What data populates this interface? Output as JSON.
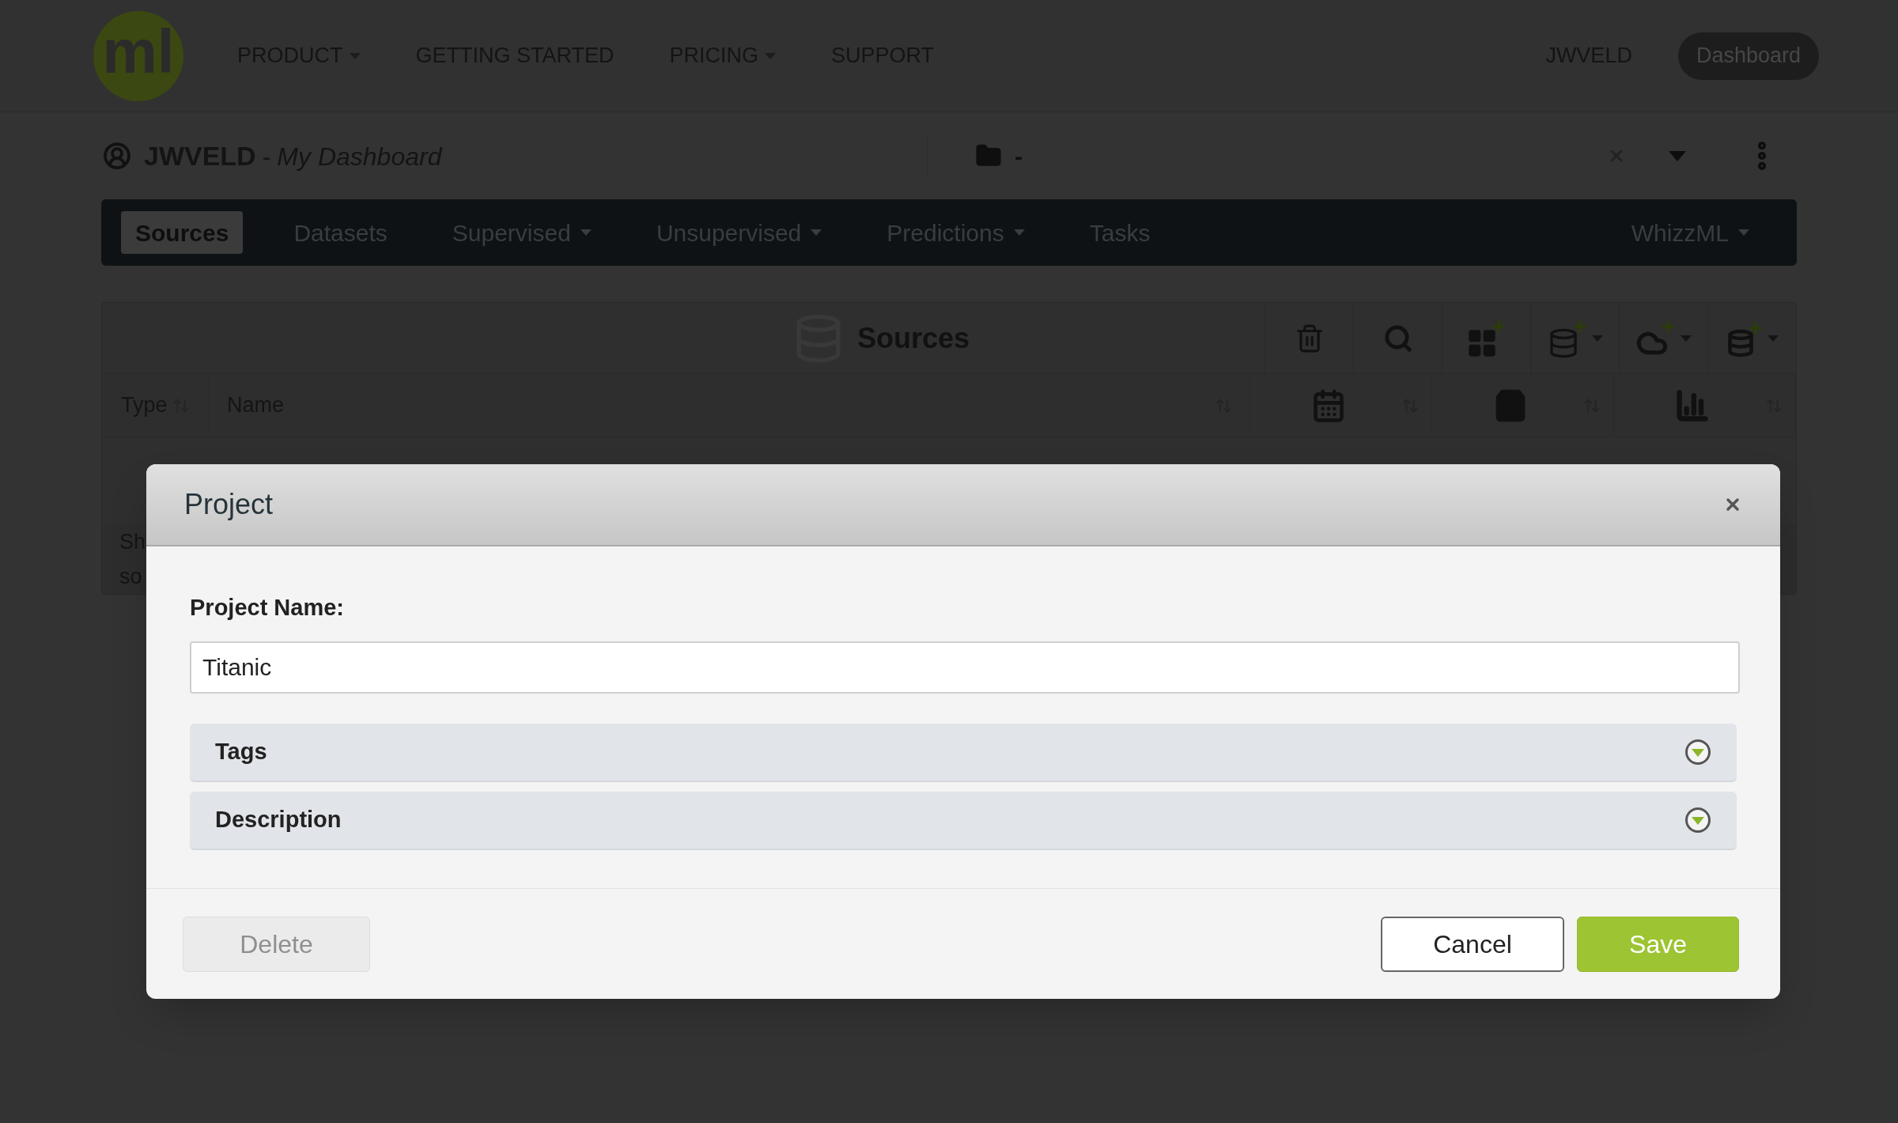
{
  "top_nav": {
    "logo": "ml",
    "items": [
      {
        "label": "PRODUCT",
        "dropdown": true
      },
      {
        "label": "GETTING STARTED",
        "dropdown": false
      },
      {
        "label": "PRICING",
        "dropdown": true
      },
      {
        "label": "SUPPORT",
        "dropdown": false
      }
    ],
    "user": "JWVELD",
    "dashboard_button": "Dashboard"
  },
  "dashboard_header": {
    "user": "JWVELD",
    "separator": "-",
    "subtitle": "My Dashboard",
    "project": "-"
  },
  "tabs": [
    {
      "label": "Sources",
      "selected": true,
      "dropdown": false
    },
    {
      "label": "Datasets",
      "selected": false,
      "dropdown": false
    },
    {
      "label": "Supervised",
      "selected": false,
      "dropdown": true
    },
    {
      "label": "Unsupervised",
      "selected": false,
      "dropdown": true
    },
    {
      "label": "Predictions",
      "selected": false,
      "dropdown": true
    },
    {
      "label": "Tasks",
      "selected": false,
      "dropdown": false
    }
  ],
  "tab_right": {
    "label": "WhizzML",
    "dropdown": true
  },
  "panel": {
    "title": "Sources",
    "columns": [
      {
        "label": "Type"
      },
      {
        "label": "Name"
      }
    ],
    "footer_lines": [
      "Sh",
      "so"
    ]
  },
  "dialog": {
    "title": "Project",
    "field_label": "Project Name:",
    "field_value": "Titanic",
    "sections": [
      {
        "label": "Tags",
        "expanded": false
      },
      {
        "label": "Description",
        "expanded": false
      }
    ],
    "buttons": [
      {
        "label": "Delete",
        "kind": "delete",
        "disabled": true
      },
      {
        "label": "Cancel",
        "kind": "cancel",
        "disabled": false
      },
      {
        "label": "Save",
        "kind": "save",
        "disabled": false
      }
    ]
  }
}
